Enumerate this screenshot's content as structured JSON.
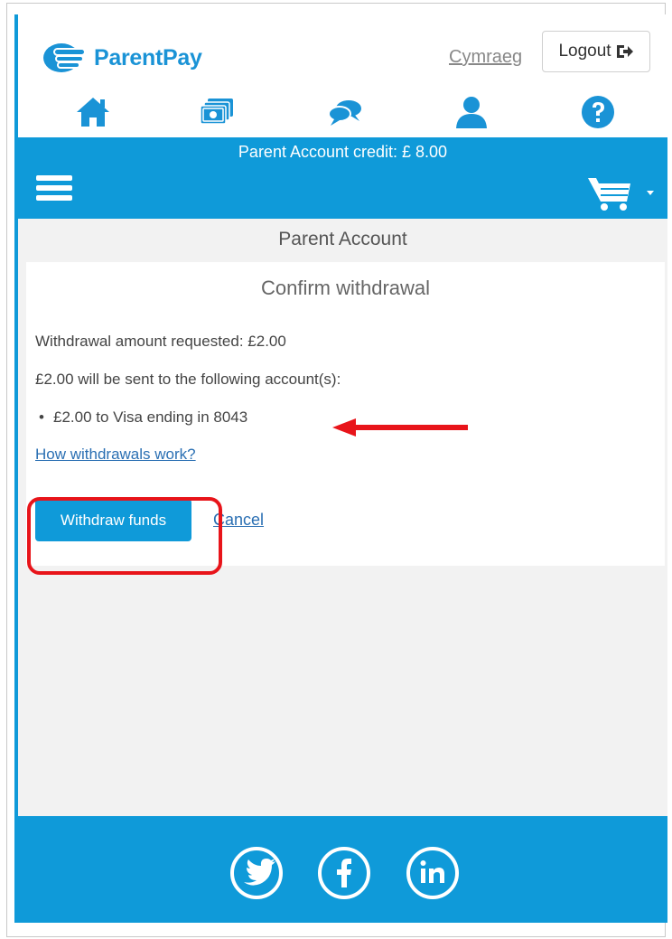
{
  "app": {
    "name": "ParentPay",
    "language_link": "Cymraeg",
    "logout_label": "Logout"
  },
  "nav": {
    "icons": [
      "home-icon",
      "payments-icon",
      "messages-icon",
      "profile-icon",
      "help-icon"
    ]
  },
  "credit_bar": {
    "text": "Parent Account credit: £ 8.00"
  },
  "page": {
    "section_title": "Parent Account",
    "card_title": "Confirm withdrawal",
    "amount_line": "Withdrawal amount requested: £2.00",
    "sent_line": "£2.00 will be sent to the following account(s):",
    "accounts": [
      "£2.00 to Visa ending in 8043"
    ],
    "help_link": "How withdrawals work?",
    "withdraw_button": "Withdraw funds",
    "cancel_link": "Cancel"
  },
  "footer": {
    "social": [
      "twitter-icon",
      "facebook-icon",
      "linkedin-icon"
    ]
  },
  "colors": {
    "brand_blue": "#0f9ad9",
    "logo_blue": "#1a93d6",
    "link_blue": "#2a6fb3",
    "annotation_red": "#e8141a",
    "page_background": "#f2f2f2"
  }
}
